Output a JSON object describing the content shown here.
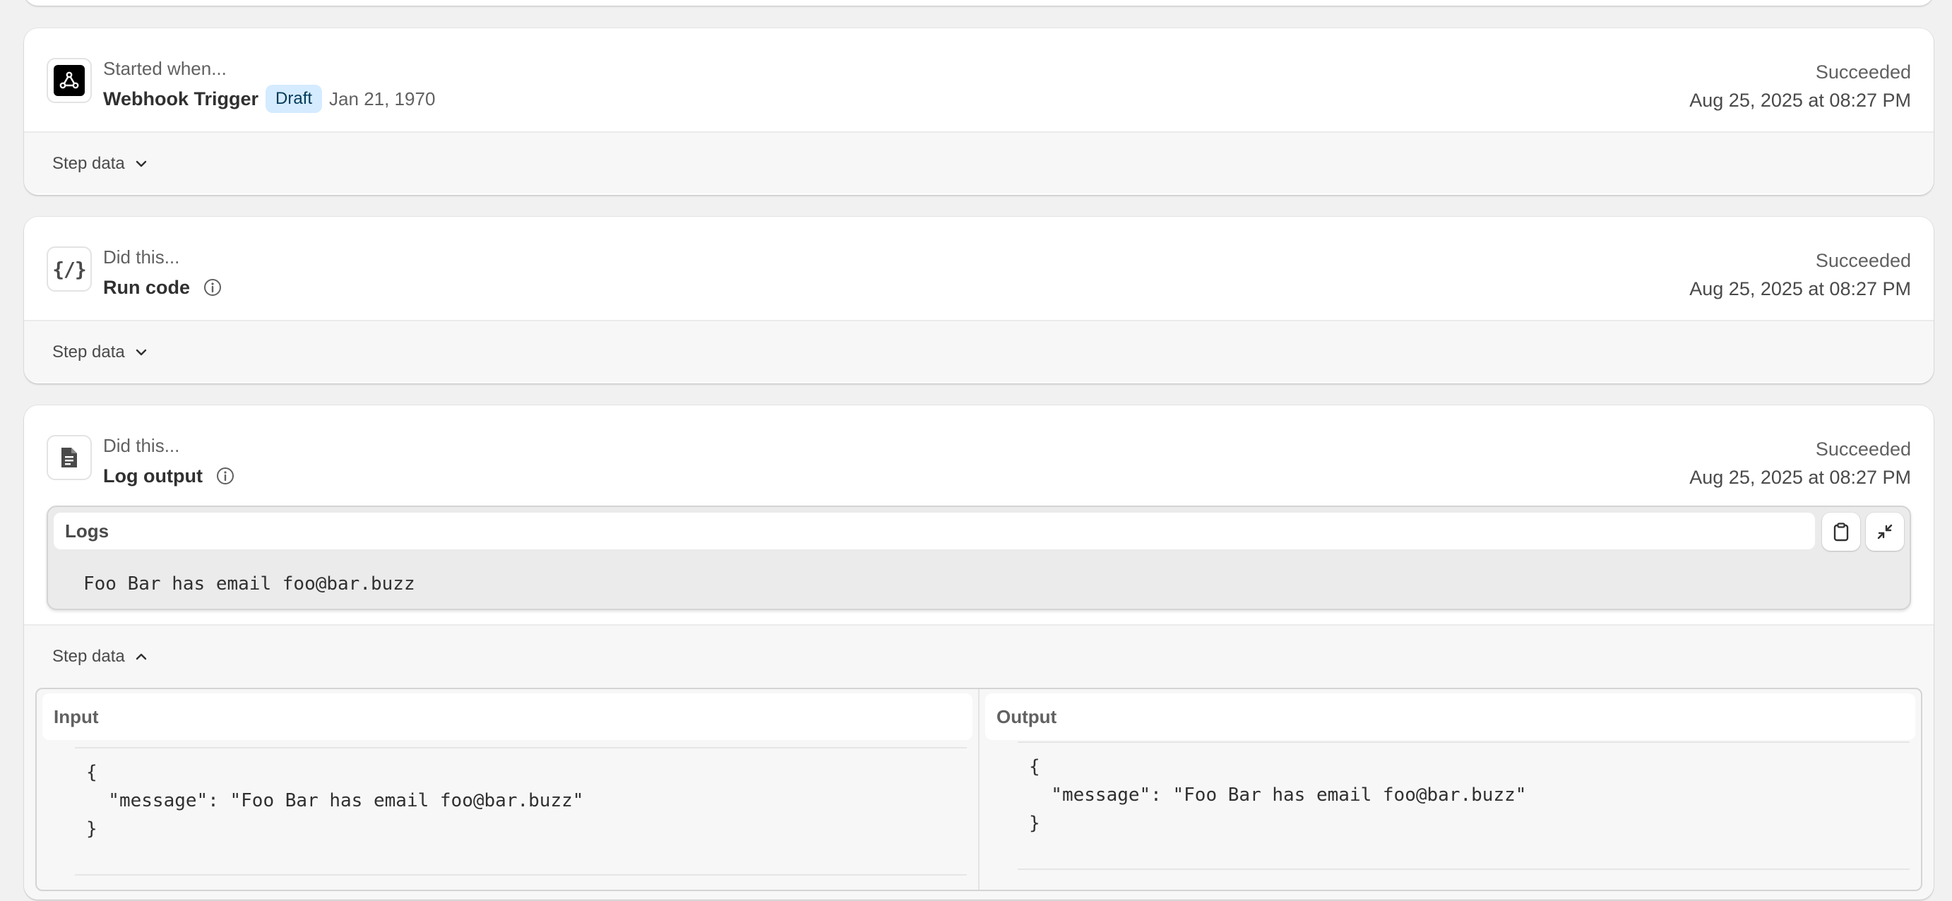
{
  "steps": [
    {
      "kicker": "Started when...",
      "title": "Webhook Trigger",
      "badge": "Draft",
      "date": "Jan 21, 1970",
      "status": "Succeeded",
      "timestamp": "Aug 25, 2025 at 08:27 PM",
      "step_data_label": "Step data",
      "icon": "webhook-icon",
      "expanded": false
    },
    {
      "kicker": "Did this...",
      "title": "Run code",
      "status": "Succeeded",
      "timestamp": "Aug 25, 2025 at 08:27 PM",
      "step_data_label": "Step data",
      "icon": "code-icon",
      "icon_text": "{/}",
      "expanded": false
    },
    {
      "kicker": "Did this...",
      "title": "Log output",
      "status": "Succeeded",
      "timestamp": "Aug 25, 2025 at 08:27 PM",
      "step_data_label": "Step data",
      "icon": "document-icon",
      "expanded": true,
      "logs": {
        "title": "Logs",
        "line": "Foo Bar has email foo@bar.buzz"
      },
      "input": {
        "title": "Input",
        "code": "{\n  \"message\": \"Foo Bar has email foo@bar.buzz\"\n}"
      },
      "output": {
        "title": "Output",
        "code": "{\n  \"message\": \"Foo Bar has email foo@bar.buzz\"\n}"
      }
    }
  ]
}
